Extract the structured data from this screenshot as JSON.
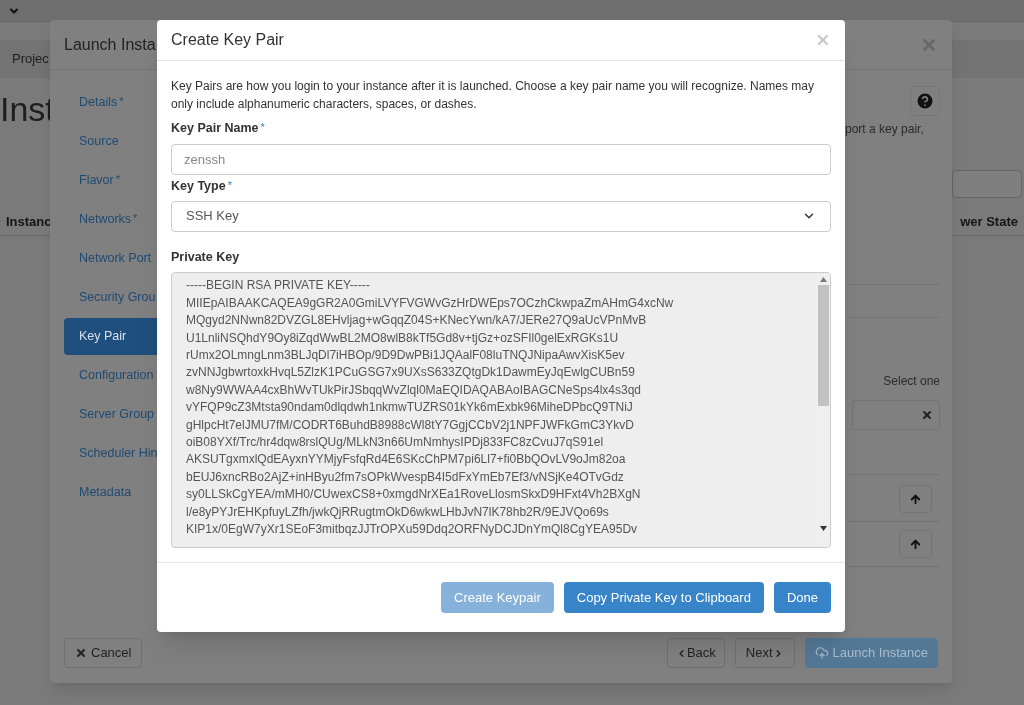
{
  "page": {
    "breadcrumb": "Projec",
    "heading": "Inst",
    "table_columns": [
      {
        "label": "Instanc"
      },
      {
        "label": "wer State"
      }
    ]
  },
  "launch_dialog": {
    "title": "Launch Insta",
    "steps": [
      {
        "label": "Details",
        "marker": "*",
        "selected": false
      },
      {
        "label": "Source",
        "selected": false
      },
      {
        "label": "Flavor",
        "marker": "*",
        "selected": false
      },
      {
        "label": "Networks",
        "marker": "*",
        "selected": false
      },
      {
        "label": "Network Port",
        "selected": false
      },
      {
        "label": "Security Grou",
        "selected": false
      },
      {
        "label": "Key Pair",
        "selected": true
      },
      {
        "label": "Configuration",
        "selected": false
      },
      {
        "label": "Server Group",
        "selected": false
      },
      {
        "label": "Scheduler Hin",
        "selected": false
      },
      {
        "label": "Metadata",
        "selected": false
      }
    ],
    "intro_fragment": "port a key pair,",
    "select_label": "Select one",
    "buttons": {
      "cancel": "Cancel",
      "back": "Back",
      "next": "Next",
      "launch": "Launch Instance"
    }
  },
  "key_dialog": {
    "title": "Create Key Pair",
    "description": "Key Pairs are how you login to your instance after it is launched. Choose a key pair name you will recognize. Names may only include alphanumeric characters, spaces, or dashes.",
    "name_field": {
      "label": "Key Pair Name",
      "marker": "*",
      "placeholder": "zenssh"
    },
    "type_field": {
      "label": "Key Type",
      "marker": "*",
      "value": "SSH Key"
    },
    "private_key": {
      "label": "Private Key",
      "lines": [
        "-----BEGIN RSA PRIVATE KEY-----",
        "MIIEpAIBAAKCAQEA9gGR2A0GmiLVYFVGWvGzHrDWEps7OCzhCkwpaZmAHmG4xcNw",
        "MQgyd2NNwn82DVZGL8EHvljag+wGqqZ04S+KNecYwn/kA7/JERe27Q9aUcVPnMvB",
        "U1LnliNSQhdY9Oy8iZqdWwBL2MO8wlB8kTf5Gd8v+tjGz+ozSFIl0gelExRGKs1U",
        "rUmx2OLmngLnm3BLJqDl7iHBOp/9D9DwPBi1JQAalF08luTNQJNipaAwvXisK5ev",
        "zvNNJgbwrtoxkHvqL5ZlzK1PCuGSG7x9UXsS633ZQtgDk1DawmEyJqEwlgCUBn59",
        "w8Ny9WWAA4cxBhWvTUkPirJSbqqWvZlql0MaEQIDAQABAoIBAGCNeSps4lx4s3qd",
        "vYFQP9cZ3Mtsta90ndam0dlqdwh1nkmwTUZRS01kYk6mExbk96MiheDPbcQ9TNiJ",
        "gHlpcHt7elJMU7fM/CODRT6BuhdB8988cWl8tY7GgjCCbV2j1NPFJWFkGmC3YkvD",
        "oiB08YXf/Trc/hr4dqw8rslQUg/MLkN3n66UmNmhysIPDj833FC8zCvuJ7qS91el",
        "AKSUTgxmxlQdEAyxnYYMjyFsfqRd4E6SKcChPM7pi6Ll7+fi0BbQOvLV9oJm82oa",
        "bEUJ6xncRBo2AjZ+inHByu2fm7sOPkWvespB4I5dFxYmEb7Ef3/vNSjKe4OTvGdz",
        "sy0LLSkCgYEA/mMH0/CUwexCS8+0xmgdNrXEa1RoveLlosmSkxD9HFxt4Vh2BXgN",
        "l/e8yPYJrEHKpfuyLZfh/jwkQjRRugtmOkD6wkwLHbJvN7lK78hb2R/9EJVQo69s",
        "KIP1x/0EgW7yXr1SEoF3mitbqzJJTrOPXu59Ddq2ORFNyDCJDnYmQl8CgYEA95Dv"
      ]
    },
    "buttons": [
      {
        "label": "Create Keypair",
        "kind": "primary",
        "disabled": true
      },
      {
        "label": "Copy Private Key to Clipboard",
        "kind": "primary",
        "disabled": false
      },
      {
        "label": "Done",
        "kind": "primary",
        "disabled": false
      }
    ]
  }
}
